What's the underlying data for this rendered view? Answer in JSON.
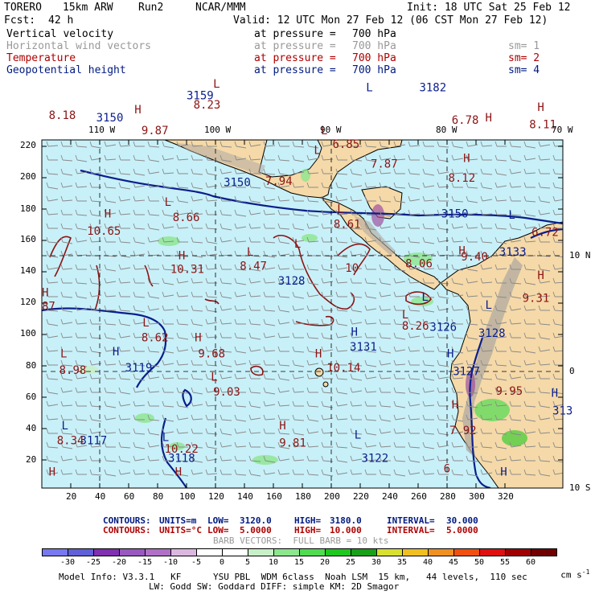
{
  "header": {
    "model": "TORERO",
    "resolution": "15km ARW",
    "run": "Run2",
    "org": "NCAR/MMM",
    "init": "Init: 18 UTC Sat 25 Feb 12",
    "fcst_label": "Fcst:",
    "fcst_value": "42 h",
    "valid": "Valid: 12 UTC Mon 27 Feb 12 (06 CST Mon 27 Feb 12)"
  },
  "fields": [
    {
      "name": "Vertical velocity",
      "at": "at pressure =",
      "level": "700 hPa",
      "sm": "",
      "color": "#000000"
    },
    {
      "name": "Horizontal wind vectors",
      "at": "at pressure =",
      "level": "700 hPa",
      "sm": "sm= 1",
      "color": "#999999"
    },
    {
      "name": "Temperature",
      "at": "at pressure =",
      "level": "700 hPa",
      "sm": "sm= 2",
      "color": "#b00000"
    },
    {
      "name": "Geopotential height",
      "at": "at pressure =",
      "level": "700 hPa",
      "sm": "sm= 4",
      "color": "#001a80"
    }
  ],
  "map": {
    "lon_labels": [
      "110 W",
      "100 W",
      "90 W",
      "80 W",
      "70 W"
    ],
    "lat_labels": [
      "10 N",
      "0",
      "10 S"
    ],
    "y_ticks": [
      "220",
      "200",
      "180",
      "160",
      "140",
      "120",
      "100",
      "80",
      "60",
      "40",
      "20"
    ],
    "x_ticks": [
      "20",
      "40",
      "60",
      "80",
      "100",
      "120",
      "140",
      "160",
      "180",
      "200",
      "220",
      "240",
      "260",
      "280",
      "300",
      "320"
    ],
    "height_labels": [
      {
        "text": "3150",
        "lon": -110.3,
        "lat": 21.6
      },
      {
        "text": "3159",
        "lon": -102.5,
        "lat": 23.5
      },
      {
        "text": "3182",
        "lon": -82.4,
        "lat": 24.2
      },
      {
        "text": "3150",
        "lon": -99.3,
        "lat": 16.0
      },
      {
        "text": "3150",
        "lon": -80.5,
        "lat": 13.3
      },
      {
        "text": "3128",
        "lon": -94.6,
        "lat": 7.5
      },
      {
        "text": "3126",
        "lon": -81.5,
        "lat": 3.5
      },
      {
        "text": "3128",
        "lon": -77.3,
        "lat": 3.0
      },
      {
        "text": "3131",
        "lon": -88.4,
        "lat": 1.8
      },
      {
        "text": "3119",
        "lon": -107.8,
        "lat": 0.0
      },
      {
        "text": "3127",
        "lon": -79.5,
        "lat": -0.3
      },
      {
        "text": "3117",
        "lon": -111.7,
        "lat": -6.3
      },
      {
        "text": "3118",
        "lon": -104.1,
        "lat": -7.8
      },
      {
        "text": "3122",
        "lon": -87.4,
        "lat": -7.8
      },
      {
        "text": "3133",
        "lon": -75.5,
        "lat": 10.0
      },
      {
        "text": "313",
        "lon": -70.9,
        "lat": -3.7
      }
    ],
    "temp_labels": [
      {
        "text": "8.18",
        "lon": -114.4,
        "lat": 21.8
      },
      {
        "text": "9.87",
        "lon": -106.4,
        "lat": 20.5
      },
      {
        "text": "8.23",
        "lon": -101.9,
        "lat": 22.7
      },
      {
        "text": "6.85",
        "lon": -89.9,
        "lat": 19.3
      },
      {
        "text": "7.87",
        "lon": -86.6,
        "lat": 17.6
      },
      {
        "text": "6.78",
        "lon": -79.6,
        "lat": 21.4
      },
      {
        "text": "8.11",
        "lon": -72.9,
        "lat": 21.0
      },
      {
        "text": "8.12",
        "lon": -79.9,
        "lat": 16.4
      },
      {
        "text": "7.94",
        "lon": -95.7,
        "lat": 16.1
      },
      {
        "text": "8.66",
        "lon": -103.7,
        "lat": 13.0
      },
      {
        "text": "8.61",
        "lon": -89.8,
        "lat": 12.4
      },
      {
        "text": "10.65",
        "lon": -111.1,
        "lat": 11.8
      },
      {
        "text": "6.72",
        "lon": -72.7,
        "lat": 11.7
      },
      {
        "text": "10.31",
        "lon": -103.9,
        "lat": 8.5
      },
      {
        "text": "8.47",
        "lon": -97.9,
        "lat": 8.8
      },
      {
        "text": "10",
        "lon": -88.8,
        "lat": 8.6
      },
      {
        "text": "8.06",
        "lon": -83.6,
        "lat": 9.0
      },
      {
        "text": "9.40",
        "lon": -78.8,
        "lat": 9.6
      },
      {
        "text": "9.31",
        "lon": -73.5,
        "lat": 6.0
      },
      {
        "text": "87",
        "lon": -115.0,
        "lat": 5.3
      },
      {
        "text": "8.26",
        "lon": -83.9,
        "lat": 3.6
      },
      {
        "text": "8.62",
        "lon": -106.4,
        "lat": 2.6
      },
      {
        "text": "9.68",
        "lon": -101.5,
        "lat": 1.2
      },
      {
        "text": "8.98",
        "lon": -113.5,
        "lat": -0.2
      },
      {
        "text": "10.14",
        "lon": -90.4,
        "lat": 0.0
      },
      {
        "text": "9.03",
        "lon": -100.2,
        "lat": -2.1
      },
      {
        "text": "9.95",
        "lon": -75.8,
        "lat": -2.0
      },
      {
        "text": "7.92",
        "lon": -79.8,
        "lat": -5.4
      },
      {
        "text": "8.34",
        "lon": -113.7,
        "lat": -6.3
      },
      {
        "text": "10.22",
        "lon": -104.4,
        "lat": -7.0
      },
      {
        "text": "9.81",
        "lon": -94.5,
        "lat": -6.5
      },
      {
        "text": "6",
        "lon": -80.3,
        "lat": -8.7
      }
    ],
    "hl_labels": [
      {
        "text": "H",
        "lon": -107.0,
        "lat": 22.3,
        "kind": "temp"
      },
      {
        "text": "L",
        "lon": -100.2,
        "lat": 24.5,
        "kind": "temp"
      },
      {
        "text": "L",
        "lon": -87.0,
        "lat": 24.2,
        "kind": "height"
      },
      {
        "text": "L",
        "lon": -90.9,
        "lat": 20.5,
        "kind": "temp"
      },
      {
        "text": "L",
        "lon": -91.5,
        "lat": 18.8,
        "kind": "temp"
      },
      {
        "text": "H",
        "lon": -76.7,
        "lat": 21.6,
        "kind": "temp"
      },
      {
        "text": "H",
        "lon": -72.2,
        "lat": 22.5,
        "kind": "temp"
      },
      {
        "text": "H",
        "lon": -78.6,
        "lat": 18.1,
        "kind": "temp"
      },
      {
        "text": "H",
        "lon": -109.6,
        "lat": 13.3,
        "kind": "temp"
      },
      {
        "text": "L",
        "lon": -104.4,
        "lat": 14.3,
        "kind": "temp"
      },
      {
        "text": "L",
        "lon": -89.5,
        "lat": 13.7,
        "kind": "temp"
      },
      {
        "text": "L",
        "lon": -74.7,
        "lat": 13.2,
        "kind": "height"
      },
      {
        "text": "L",
        "lon": -97.3,
        "lat": 10.0,
        "kind": "temp"
      },
      {
        "text": "L",
        "lon": -93.2,
        "lat": 10.7,
        "kind": "temp"
      },
      {
        "text": "H",
        "lon": -103.2,
        "lat": 9.7,
        "kind": "temp"
      },
      {
        "text": "H",
        "lon": -79.0,
        "lat": 10.1,
        "kind": "temp"
      },
      {
        "text": "H",
        "lon": -72.2,
        "lat": 8.0,
        "kind": "temp"
      },
      {
        "text": "H",
        "lon": -115.0,
        "lat": 6.5,
        "kind": "temp"
      },
      {
        "text": "L",
        "lon": -82.2,
        "lat": 6.1,
        "kind": "height"
      },
      {
        "text": "L",
        "lon": -76.7,
        "lat": 5.4,
        "kind": "height"
      },
      {
        "text": "L",
        "lon": -83.9,
        "lat": 4.6,
        "kind": "temp"
      },
      {
        "text": "L",
        "lon": -106.3,
        "lat": 3.9,
        "kind": "temp"
      },
      {
        "text": "H",
        "lon": -101.8,
        "lat": 2.6,
        "kind": "temp"
      },
      {
        "text": "H",
        "lon": -88.3,
        "lat": 3.1,
        "kind": "height"
      },
      {
        "text": "H",
        "lon": -108.9,
        "lat": 1.4,
        "kind": "height"
      },
      {
        "text": "L",
        "lon": -113.4,
        "lat": 1.2,
        "kind": "temp"
      },
      {
        "text": "H",
        "lon": -91.4,
        "lat": 1.2,
        "kind": "temp"
      },
      {
        "text": "H",
        "lon": -80.0,
        "lat": 1.2,
        "kind": "height"
      },
      {
        "text": "L",
        "lon": -100.4,
        "lat": -0.8,
        "kind": "temp"
      },
      {
        "text": "H",
        "lon": -71.0,
        "lat": -2.2,
        "kind": "height"
      },
      {
        "text": "H",
        "lon": -79.6,
        "lat": -3.2,
        "kind": "temp"
      },
      {
        "text": "L",
        "lon": -113.3,
        "lat": -5.0,
        "kind": "height"
      },
      {
        "text": "L",
        "lon": -104.6,
        "lat": -6.0,
        "kind": "height"
      },
      {
        "text": "H",
        "lon": -94.5,
        "lat": -5.0,
        "kind": "temp"
      },
      {
        "text": "L",
        "lon": -88.0,
        "lat": -5.8,
        "kind": "height"
      },
      {
        "text": "H",
        "lon": -114.4,
        "lat": -9.0,
        "kind": "temp"
      },
      {
        "text": "H",
        "lon": -103.5,
        "lat": -9.0,
        "kind": "temp"
      },
      {
        "text": "H",
        "lon": -75.4,
        "lat": -9.0,
        "kind": "height"
      }
    ],
    "colors": {
      "ocean": "#c8f0f8",
      "land": "#f5d9a8",
      "terrain": "#b0a9a0",
      "height_contour": "#0a1e8c",
      "temp_contour": "#8c1414",
      "barb": "#8a8a8a",
      "grid": "#000000",
      "coast": "#000000",
      "updraft": "#5adc5a",
      "downdraft": "#a050a0"
    }
  },
  "contours_info": {
    "row1": {
      "label": "CONTOURS:",
      "units": "UNITS=m",
      "low": "LOW=",
      "low_value": "3120.0",
      "high": "HIGH=",
      "high_value": "3180.0",
      "interval": "INTERVAL=",
      "interval_value": "30.000",
      "color": "#001a80"
    },
    "row2": {
      "label": "CONTOURS:",
      "units": "UNITS=°C",
      "low": "LOW=",
      "low_value": "5.0000",
      "high": "HIGH=",
      "high_value": "10.000",
      "interval": "INTERVAL=",
      "interval_value": "5.0000",
      "color": "#b00000"
    },
    "barb": "BARB VECTORS:  FULL BARB = 10 kts"
  },
  "colorbar": {
    "colors": [
      "#7878f0",
      "#6060d8",
      "#8030b0",
      "#9858c0",
      "#b070c8",
      "#dcb8e0",
      "#ffffff",
      "#ffffff",
      "#c8f0c8",
      "#8ce68c",
      "#50dc50",
      "#1ec81e",
      "#18a018",
      "#d8e030",
      "#f0c020",
      "#f09020",
      "#f05010",
      "#e01010",
      "#a00000",
      "#700000"
    ],
    "labels": [
      "-30",
      "-25",
      "-20",
      "-15",
      "-10",
      "-5",
      "0",
      "5",
      "10",
      "15",
      "20",
      "25",
      "30",
      "35",
      "40",
      "45",
      "50",
      "55",
      "60"
    ],
    "units": "cm s",
    "units_exp": "-1"
  },
  "footer": {
    "line1": "Model Info: V3.3.1   KF      YSU PBL  WDM 6class  Noah LSM  15 km,   44 levels,  110 sec",
    "line2": "LW: Godd SW: Goddard DIFF: simple KM: 2D Smagor"
  }
}
